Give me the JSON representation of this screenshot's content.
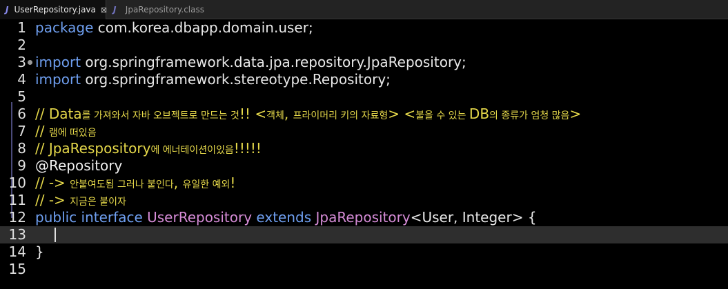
{
  "tabs": [
    {
      "icon": "java-file-icon",
      "label": "UserRepository.java",
      "close": "⊠",
      "active": true
    },
    {
      "icon": "class-file-icon",
      "label": "JpaRepository.class",
      "active": false
    }
  ],
  "editor": {
    "lines": [
      {
        "no": "1",
        "parts": [
          [
            "kw",
            "package"
          ],
          [
            "plain",
            " com.korea.dbapp.domain.user;"
          ]
        ]
      },
      {
        "no": "2",
        "parts": []
      },
      {
        "no": "3",
        "marker": true,
        "parts": [
          [
            "kw",
            "import"
          ],
          [
            "plain",
            " org.springframework.data.jpa.repository.JpaRepository;"
          ]
        ]
      },
      {
        "no": "4",
        "parts": [
          [
            "kw",
            "import"
          ],
          [
            "plain",
            " org.springframework.stereotype.Repository;"
          ]
        ]
      },
      {
        "no": "5",
        "parts": []
      },
      {
        "no": "6",
        "parts": [
          [
            "cmt",
            "// Data"
          ],
          [
            "cmt-kr",
            "를 가져와서 자바 오브젝트로 만드는 것"
          ],
          [
            "cmt",
            "!! <"
          ],
          [
            "cmt-kr",
            "객체"
          ],
          [
            "cmt",
            ", "
          ],
          [
            "cmt-kr",
            "프라이머리 키의 자료형"
          ],
          [
            "cmt",
            "> <"
          ],
          [
            "cmt-kr",
            "불을 수 있는 "
          ],
          [
            "cmt",
            "DB"
          ],
          [
            "cmt-kr",
            "의 종류가 엄청 많음"
          ],
          [
            "cmt",
            ">"
          ]
        ]
      },
      {
        "no": "7",
        "parts": [
          [
            "cmt",
            "// "
          ],
          [
            "cmt-kr",
            "램에 떠있음"
          ]
        ]
      },
      {
        "no": "8",
        "parts": [
          [
            "cmt",
            "// JpaRespository"
          ],
          [
            "cmt-kr",
            "에 에너테이션이있음"
          ],
          [
            "cmt",
            "!!!!!"
          ]
        ]
      },
      {
        "no": "9",
        "parts": [
          [
            "ann",
            "@Repository"
          ]
        ]
      },
      {
        "no": "10",
        "parts": [
          [
            "cmt",
            "// -> "
          ],
          [
            "cmt-kr",
            "안붙여도됨 그러나 붙인다"
          ],
          [
            "cmt",
            ", "
          ],
          [
            "cmt-kr",
            "유일한 예외"
          ],
          [
            "cmt",
            "!"
          ]
        ]
      },
      {
        "no": "11",
        "parts": [
          [
            "cmt",
            "// -> "
          ],
          [
            "cmt-kr",
            "지금은 붙이자"
          ]
        ]
      },
      {
        "no": "12",
        "parts": [
          [
            "kw",
            "public"
          ],
          [
            "plain",
            " "
          ],
          [
            "kw",
            "interface"
          ],
          [
            "plain",
            " "
          ],
          [
            "cls",
            "UserRepository"
          ],
          [
            "plain",
            " "
          ],
          [
            "kw",
            "extends"
          ],
          [
            "plain",
            " "
          ],
          [
            "cls",
            "JpaRepository"
          ],
          [
            "plain",
            "<User, Integer> {"
          ]
        ]
      },
      {
        "no": "13",
        "current": true,
        "parts": [
          [
            "plain",
            "    "
          ]
        ]
      },
      {
        "no": "14",
        "parts": [
          [
            "plain",
            "}"
          ]
        ]
      },
      {
        "no": "15",
        "parts": []
      }
    ]
  }
}
